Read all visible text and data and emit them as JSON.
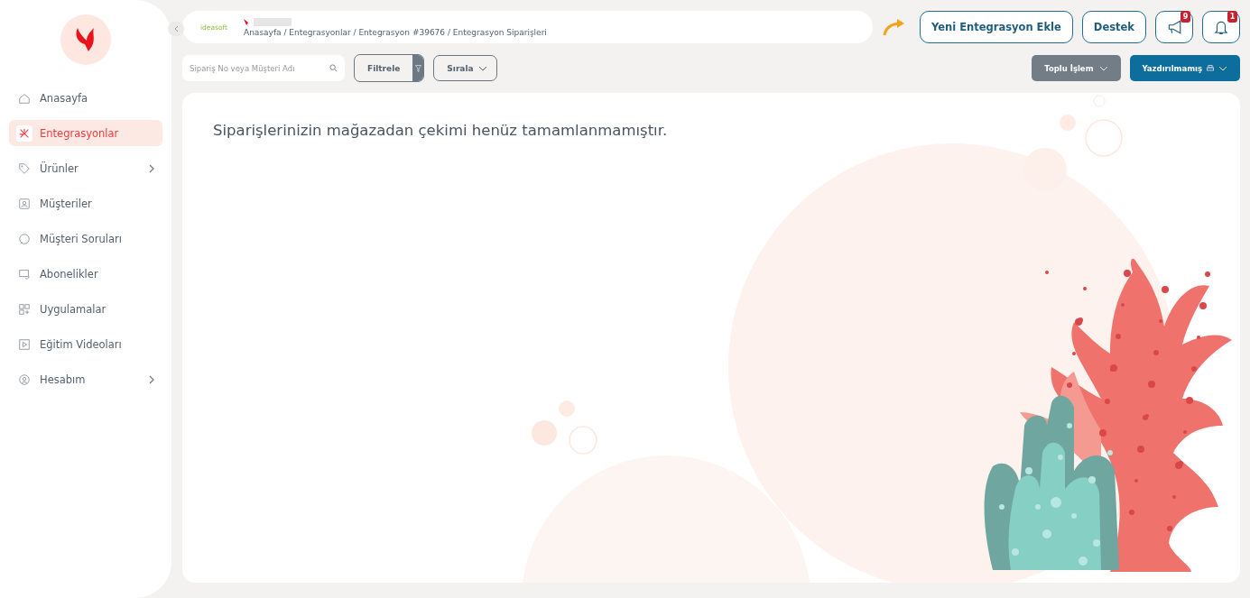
{
  "sidebar": {
    "items": [
      {
        "label": "Anasayfa",
        "kind": "home",
        "selected": false,
        "has_submenu": false
      },
      {
        "label": "Entegrasyonlar",
        "kind": "network",
        "selected": true,
        "has_submenu": false
      },
      {
        "label": "Ürünler",
        "kind": "tag",
        "selected": false,
        "has_submenu": true
      },
      {
        "label": "Müşteriler",
        "kind": "person",
        "selected": false,
        "has_submenu": false
      },
      {
        "label": "Müşteri Soruları",
        "kind": "chat",
        "selected": false,
        "has_submenu": false
      },
      {
        "label": "Abonelikler",
        "kind": "card",
        "selected": false,
        "has_submenu": false
      },
      {
        "label": "Uygulamalar",
        "kind": "apps",
        "selected": false,
        "has_submenu": false
      },
      {
        "label": "Eğitim Videoları",
        "kind": "video",
        "selected": false,
        "has_submenu": false
      },
      {
        "label": "Hesabım",
        "kind": "user",
        "selected": false,
        "has_submenu": true
      }
    ]
  },
  "header": {
    "logo_text": "ideasoft",
    "breadcrumb": "Anasayfa / Entegrasyonlar / Entegrasyon #39676 / Entegrasyon Siparişleri",
    "buttons": [
      {
        "label": "Yeni Entegrasyon Ekle"
      },
      {
        "label": "Destek"
      }
    ],
    "icon_buttons": [
      {
        "kind": "megaphone",
        "badge": "9"
      },
      {
        "kind": "bell",
        "badge": "1"
      }
    ]
  },
  "toolbar": {
    "search": {
      "placeholder": "Sipariş No veya Müşteri Adı"
    },
    "filter": "Filtrele",
    "sort": "Sırala",
    "bulk": "Toplu İşlem",
    "print_filter": "Yazdırılmamış"
  },
  "content": {
    "message": "Siparişlerinizin mağazadan çekimi henüz tamamlanmamıştır."
  }
}
